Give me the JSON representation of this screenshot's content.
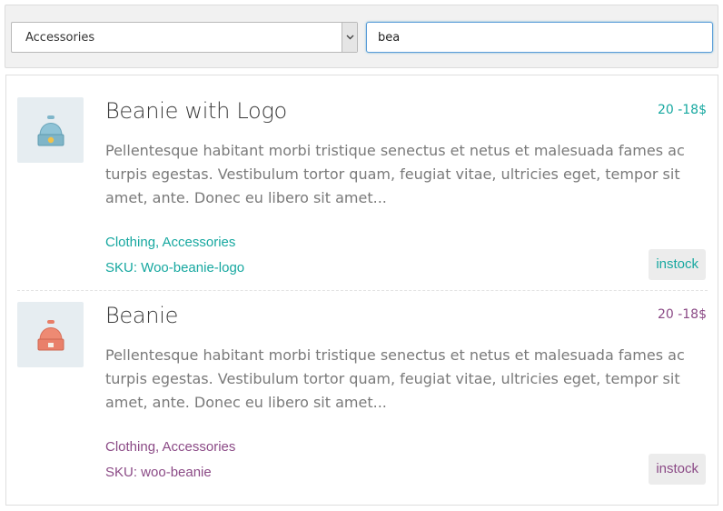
{
  "filters": {
    "category_value": "Accessories",
    "search_value": "bea"
  },
  "colors": {
    "teal": "#17a8a0",
    "purple": "#8b4a86"
  },
  "products": [
    {
      "title": "Beanie with Logo",
      "price": "20 -18$",
      "description": "Pellentesque habitant morbi tristique senectus et netus et malesuada fames ac turpis egestas. Vestibulum tortor quam, feugiat vitae, ultricies eget, tempor sit amet, ante. Donec eu libero sit amet...",
      "categories": "Clothing, Accessories",
      "sku": "SKU: Woo-beanie-logo",
      "stock": "instock",
      "image_icon": "blue-beanie-icon"
    },
    {
      "title": "Beanie",
      "price": "20 -18$",
      "description": "Pellentesque habitant morbi tristique senectus et netus et malesuada fames ac turpis egestas. Vestibulum tortor quam, feugiat vitae, ultricies eget, tempor sit amet, ante. Donec eu libero sit amet...",
      "categories": "Clothing, Accessories",
      "sku": "SKU: woo-beanie",
      "stock": "instock",
      "image_icon": "orange-beanie-icon"
    }
  ]
}
